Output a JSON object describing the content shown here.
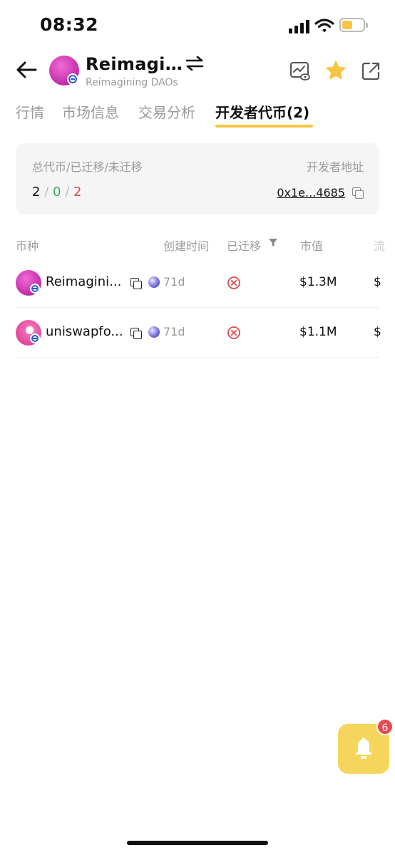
{
  "status_bar": {
    "time": "08:32"
  },
  "header": {
    "token_name": "Reimagi…",
    "token_full_name": "Reimagining DAOs"
  },
  "tabs": [
    {
      "label": "行情",
      "active": false
    },
    {
      "label": "市场信息",
      "active": false
    },
    {
      "label": "交易分析",
      "active": false
    },
    {
      "label": "开发者代币(2)",
      "active": true
    }
  ],
  "summary": {
    "label": "总代币/已迁移/未迁移",
    "dev_address_label": "开发者地址",
    "total": "2",
    "separator": "/",
    "migrated": "0",
    "not_migrated": "2",
    "dev_address": "0x1e...4685"
  },
  "table": {
    "columns": [
      "币种",
      "创建时间",
      "已迁移",
      "市值",
      "流"
    ],
    "rows": [
      {
        "name": "Reimagini...",
        "age": "71d",
        "migrated": false,
        "market_cap": "$1.3M",
        "cut": "$"
      },
      {
        "name": "uniswapfo...",
        "age": "71d",
        "migrated": false,
        "market_cap": "$1.1M",
        "cut": "$"
      }
    ]
  },
  "notifications": {
    "count": "6"
  },
  "colors": {
    "accent_yellow": "#f6c543",
    "migrated_green": "#3aa65c",
    "pending_red": "#e04a4a",
    "avatar_pink": "#d63cb8"
  }
}
